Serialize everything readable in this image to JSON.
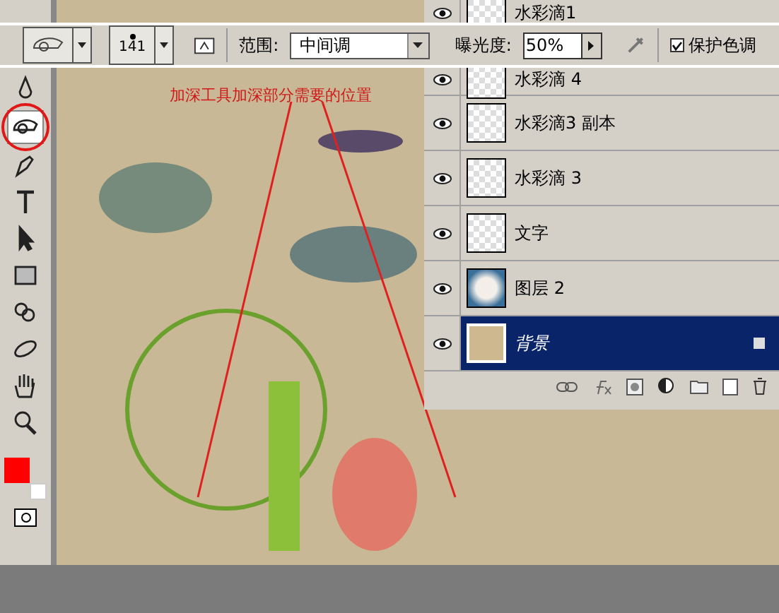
{
  "tool_options": {
    "brush_size": "141",
    "range_label": "范围:",
    "range_value": "中间调",
    "exposure_label": "曝光度:",
    "exposure_value": "50%",
    "protect_tones": {
      "label": "保护色调",
      "checked": true
    }
  },
  "toolbox": {
    "tools": [
      {
        "kind": "drop",
        "selected": false
      },
      {
        "kind": "burn",
        "selected": true
      },
      {
        "kind": "pen",
        "selected": false
      },
      {
        "kind": "type",
        "selected": false
      },
      {
        "kind": "arrow",
        "selected": false
      },
      {
        "kind": "rect",
        "selected": false
      },
      {
        "kind": "rotate",
        "selected": false
      },
      {
        "kind": "orbit",
        "selected": false
      },
      {
        "kind": "hand",
        "selected": false
      },
      {
        "kind": "zoom",
        "selected": false
      }
    ],
    "swatches": [
      {
        "kind": "foreground",
        "color": "#ff0000"
      },
      {
        "kind": "background",
        "color": "#ffffff"
      }
    ]
  },
  "annotation": {
    "note": "加深工具加深部分需要的位置"
  },
  "layers": [
    {
      "name": "水彩滴1",
      "visible": true,
      "selected": false,
      "kind": "transparent",
      "locked": false
    },
    {
      "name": "水彩滴 4",
      "visible": true,
      "selected": false,
      "kind": "transparent",
      "locked": false
    },
    {
      "name": "水彩滴3 副本",
      "visible": true,
      "selected": false,
      "kind": "transparent",
      "locked": false
    },
    {
      "name": "水彩滴 3",
      "visible": true,
      "selected": false,
      "kind": "transparent",
      "locked": false
    },
    {
      "name": "文字",
      "visible": true,
      "selected": false,
      "kind": "transparent",
      "locked": false
    },
    {
      "name": "图层 2",
      "visible": true,
      "selected": false,
      "kind": "art",
      "locked": false
    },
    {
      "name": "背景",
      "visible": true,
      "selected": true,
      "kind": "paper",
      "locked": true
    }
  ]
}
